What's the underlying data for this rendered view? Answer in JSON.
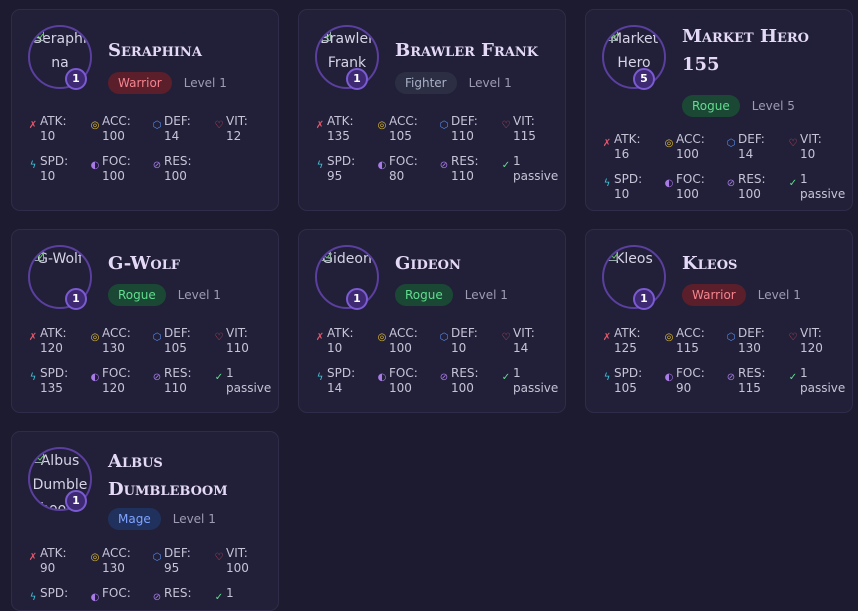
{
  "characters": [
    {
      "name": "Seraphina",
      "avatar_alt": "Seraphina",
      "class": "Warrior",
      "class_key": "warrior",
      "level_text": "Level 1",
      "level_badge": "1",
      "stats": {
        "atk": "10",
        "acc": "100",
        "def": "14",
        "vit": "12",
        "spd": "10",
        "foc": "100",
        "res": "100"
      }
    },
    {
      "name": "Brawler Frank",
      "avatar_alt": "Brawler Frank",
      "class": "Fighter",
      "class_key": "fighter",
      "level_text": "Level 1",
      "level_badge": "1",
      "stats": {
        "atk": "135",
        "acc": "105",
        "def": "110",
        "vit": "115",
        "spd": "95",
        "foc": "80",
        "res": "110"
      },
      "passive": "1 passive"
    },
    {
      "name": "Market Hero 155",
      "avatar_alt": "Market Hero",
      "class": "Rogue",
      "class_key": "rogue",
      "level_text": "Level 5",
      "level_badge": "5",
      "stats": {
        "atk": "16",
        "acc": "100",
        "def": "14",
        "vit": "10",
        "spd": "10",
        "foc": "100",
        "res": "100"
      },
      "passive": "1 passive"
    },
    {
      "name": "G-Wolf",
      "avatar_alt": "G-Wolf",
      "class": "Rogue",
      "class_key": "rogue",
      "level_text": "Level 1",
      "level_badge": "1",
      "stats": {
        "atk": "120",
        "acc": "130",
        "def": "105",
        "vit": "110",
        "spd": "135",
        "foc": "120",
        "res": "110"
      },
      "passive": "1 passive"
    },
    {
      "name": "Gideon",
      "avatar_alt": "Gideon",
      "class": "Rogue",
      "class_key": "rogue",
      "level_text": "Level 1",
      "level_badge": "1",
      "stats": {
        "atk": "10",
        "acc": "100",
        "def": "10",
        "vit": "14",
        "spd": "14",
        "foc": "100",
        "res": "100"
      },
      "passive": "1 passive"
    },
    {
      "name": "Kleos",
      "avatar_alt": "Kleos",
      "class": "Warrior",
      "class_key": "warrior",
      "level_text": "Level 1",
      "level_badge": "1",
      "stats": {
        "atk": "125",
        "acc": "115",
        "def": "130",
        "vit": "120",
        "spd": "105",
        "foc": "90",
        "res": "115"
      },
      "passive": "1 passive"
    },
    {
      "name": "Albus Dumbleboom",
      "avatar_alt": "Albus Dumbleboom",
      "class": "Mage",
      "class_key": "mage",
      "level_text": "Level 1",
      "level_badge": "1",
      "stats": {
        "atk": "90",
        "acc": "130",
        "def": "95",
        "vit": "100",
        "spd": "",
        "foc": "",
        "res": ""
      },
      "passive": "1"
    }
  ],
  "stat_labels": {
    "atk": "ATK:",
    "acc": "ACC:",
    "def": "DEF:",
    "vit": "VIT:",
    "spd": "SPD:",
    "foc": "FOC:",
    "res": "RES:"
  },
  "icons": {
    "atk": "swords-icon",
    "acc": "target-icon",
    "def": "shield-icon",
    "vit": "heart-icon",
    "spd": "lightning-icon",
    "foc": "focus-icon",
    "res": "resist-icon",
    "passive": "check-icon"
  },
  "colors": {
    "atk": "#e2566b",
    "acc": "#e6c13a",
    "def": "#5a8ff0",
    "vit": "#e2566b",
    "spd": "#3fc4d6",
    "foc": "#a97be8",
    "res": "#a97be8",
    "passive": "#61dd8f",
    "level_ring": "#7b5ad2"
  }
}
